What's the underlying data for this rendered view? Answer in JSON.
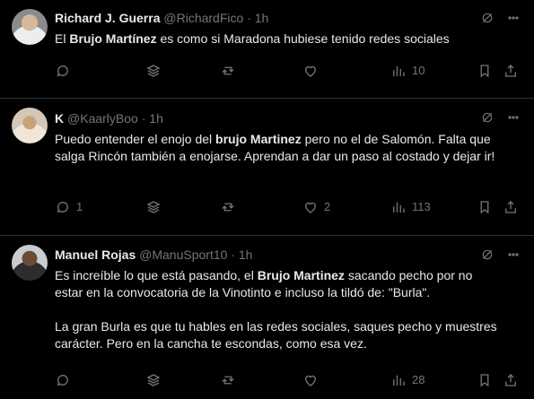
{
  "tweets": [
    {
      "name": "Richard J. Guerra",
      "handle": "@RichardFico",
      "time": "1h",
      "text_parts": [
        "El ",
        "Brujo Martínez",
        " es como si Maradona hubiese tenido redes sociales"
      ],
      "counts": {
        "reply": "",
        "retweet": "",
        "like": "",
        "views": "10"
      }
    },
    {
      "name": "K",
      "handle": "@KaarlyBoo",
      "time": "1h",
      "text_parts": [
        "Puedo entender el enojo del ",
        "brujo Martinez",
        " pero no el de Salomón. Falta que salga Rincón también a enojarse. Aprendan a dar un paso al costado y dejar ir!"
      ],
      "counts": {
        "reply": "1",
        "retweet": "",
        "like": "2",
        "views": "113"
      }
    },
    {
      "name": "Manuel Rojas",
      "handle": "@ManuSport10",
      "time": "1h",
      "text_parts": [
        "Es increíble lo que está pasando, el ",
        "Brujo Martinez",
        " sacando pecho por no estar en la convocatoria de la Vinotinto e incluso la tildó de: \"Burla\"."
      ],
      "text2": "La gran Burla es que tu hables en las redes sociales, saques pecho y muestres carácter. Pero en la cancha te escondas, como esa vez.",
      "counts": {
        "reply": "",
        "retweet": "",
        "like": "",
        "views": "28"
      }
    }
  ],
  "separator": "·",
  "icon_names": [
    "reply-icon",
    "stack-icon",
    "retweet-icon",
    "heart-icon",
    "views-icon",
    "bookmark-icon",
    "share-icon",
    "grok-icon",
    "more-icon"
  ]
}
